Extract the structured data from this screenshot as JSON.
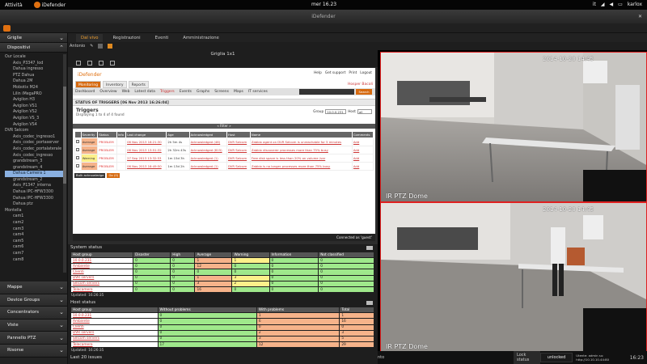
{
  "topbar": {
    "activities": "Attività",
    "app": "iDefender",
    "clock": "mer 16.23",
    "lang": "it",
    "user": "karlox"
  },
  "window": {
    "title": "iDefender"
  },
  "sidebar": {
    "top_sections": [
      {
        "label": "Griglie"
      },
      {
        "label": "Dispositivi"
      }
    ],
    "tree": [
      {
        "label": "Our Locale",
        "level": 1
      },
      {
        "label": "Axis_P3347_Iod",
        "level": 2
      },
      {
        "label": "Dahua ingresso",
        "level": 2
      },
      {
        "label": "PTZ Dahua",
        "level": 2
      },
      {
        "label": "Dahua 2M",
        "level": 2
      },
      {
        "label": "Mobotix M24",
        "level": 2
      },
      {
        "label": "Lilin iMegaPRO",
        "level": 2
      },
      {
        "label": "Avigilon H3",
        "level": 2
      },
      {
        "label": "Avigilon VS1",
        "level": 2
      },
      {
        "label": "Avigilon VS2",
        "level": 2
      },
      {
        "label": "Avigilon VS_3",
        "level": 2
      },
      {
        "label": "Avigilon VS4",
        "level": 2
      },
      {
        "label": "DVR Selcom",
        "level": 1
      },
      {
        "label": "Axis_codec_ingresso1",
        "level": 2
      },
      {
        "label": "Axis_codec_portaserver",
        "level": 2
      },
      {
        "label": "Axis_codec_portalaterale",
        "level": 2
      },
      {
        "label": "Axis_codec_ingresso",
        "level": 2
      },
      {
        "label": "grandstream_3",
        "level": 2
      },
      {
        "label": "grandstream_4",
        "level": 2
      },
      {
        "label": "Dahua Camera 1",
        "level": 2,
        "selected": true
      },
      {
        "label": "grandstream_2",
        "level": 2
      },
      {
        "label": "Axis_P1347_interna",
        "level": 2
      },
      {
        "label": "Dahua IPC-HFW3300",
        "level": 2
      },
      {
        "label": "Dahua IPC-HFW3300",
        "level": 2
      },
      {
        "label": "Dahua ptz",
        "level": 2
      },
      {
        "label": "Montella",
        "level": 1
      },
      {
        "label": "cam1",
        "level": 2
      },
      {
        "label": "cam2",
        "level": 2
      },
      {
        "label": "cam3",
        "level": 2
      },
      {
        "label": "cam4",
        "level": 2
      },
      {
        "label": "cam5",
        "level": 2
      },
      {
        "label": "cam6",
        "level": 2
      },
      {
        "label": "cam7",
        "level": 2
      },
      {
        "label": "cam8",
        "level": 2
      }
    ],
    "bottom_sections": [
      {
        "label": "Mappe"
      },
      {
        "label": "Device Groups"
      },
      {
        "label": "Concentrators"
      },
      {
        "label": "Viste"
      },
      {
        "label": "Pannello PTZ"
      },
      {
        "label": "Risorse"
      }
    ]
  },
  "tabs": [
    {
      "label": "Dal vivo",
      "active": true
    },
    {
      "label": "Registrazioni"
    },
    {
      "label": "Eventi"
    },
    {
      "label": "Amministrazione"
    }
  ],
  "subtoolbar": {
    "label": "Antonio"
  },
  "grid": {
    "title": "Griglia 1x1"
  },
  "zabbix": {
    "brand": "iDefender",
    "top_links": [
      "Help",
      "Get support",
      "Print",
      "Logout"
    ],
    "menu1": [
      "Monitoring",
      "Inventory",
      "Reports"
    ],
    "user": "Hosper Bacoli",
    "menu2": [
      "Dashboard",
      "Overview",
      "Web",
      "Latest data",
      "Triggers",
      "Events",
      "Graphs",
      "Screens",
      "Maps",
      "IT services"
    ],
    "search_btn": "Search",
    "status_title": "STATUS OF TRIGGERS [06 Nov 2013 16:26:04]",
    "triggers_title": "Triggers",
    "displaying": "Displaying 1 to 4 of 4 found",
    "group_label": "Group",
    "group_value": "10.0.0.231",
    "host_label": "Host",
    "host_value": "all",
    "filter": "« Filter »",
    "columns": [
      "",
      "Severity",
      "Status",
      "Info",
      "Last change",
      "Age",
      "Acknowledged",
      "Host",
      "Name",
      "Comments"
    ],
    "rows": [
      {
        "severity": "Average",
        "status": "PROBLEM",
        "last": "06 Nov 2013 16:21:30",
        "age": "2h 5m 4s",
        "ack": "Acknowledged (46)",
        "host": "DVR Selcom",
        "name": "Zabbix agent on DVR Selcom is unreachable for 5 minutes",
        "comment": "Add",
        "cls": "sev-avg"
      },
      {
        "severity": "Average",
        "status": "PROBLEM",
        "last": "06 Nov 2013 13:51:32",
        "age": "2h 32m 43s",
        "ack": "Acknowledged (815)",
        "host": "DVR Selcom",
        "name": "Zabbix discoverer processes more than 75% busy",
        "comment": "Add",
        "cls": "sev-avg"
      },
      {
        "severity": "Warning",
        "status": "PROBLEM",
        "last": "27 Sep 2013 13:32:53",
        "age": "1m 15d 3h",
        "ack": "Acknowledged (1)",
        "host": "DVR Selcom",
        "name": "Free disk space is less than 20% on volume /var",
        "comment": "Add",
        "cls": "sev-warn"
      },
      {
        "severity": "Average",
        "status": "PROBLEM",
        "last": "06 Nov 2013 16:49:50",
        "age": "1m 13d 2h",
        "ack": "Acknowledged (1)",
        "host": "DVR Selcom",
        "name": "Zabbix is no longer processes more than 75% busy",
        "comment": "Add",
        "cls": "sev-avg"
      }
    ],
    "bulk_ack": "Bulk acknowledge",
    "go": "Go (0)",
    "connected": "Connected as 'guest'"
  },
  "system_status": {
    "title": "System status",
    "columns": [
      "Host group",
      "Disaster",
      "High",
      "Average",
      "Warning",
      "Information",
      "Not classified"
    ],
    "rows": [
      {
        "group": "10.0.0.231",
        "vals": [
          "0",
          "0",
          "1",
          "1",
          "0",
          "0"
        ],
        "cls": [
          "c-g",
          "c-g",
          "c-o",
          "c-y",
          "c-g",
          "c-g"
        ]
      },
      {
        "group": "Ambiente",
        "vals": [
          "0",
          "0",
          "12",
          "0",
          "0",
          "0"
        ],
        "cls": [
          "c-g",
          "c-g",
          "c-o",
          "c-g",
          "c-g",
          "c-g"
        ]
      },
      {
        "group": "Clienti",
        "vals": [
          "0",
          "0",
          "0",
          "0",
          "0",
          "0"
        ],
        "cls": [
          "c-g",
          "c-g",
          "c-g",
          "c-g",
          "c-g",
          "c-g"
        ]
      },
      {
        "group": "DVR servers",
        "vals": [
          "0",
          "0",
          "1",
          "3",
          "0",
          "0"
        ],
        "cls": [
          "c-g",
          "c-g",
          "c-o",
          "c-y",
          "c-g",
          "c-g"
        ]
      },
      {
        "group": "Selcom servers",
        "vals": [
          "0",
          "0",
          "3",
          "2",
          "0",
          "0"
        ],
        "cls": [
          "c-g",
          "c-g",
          "c-o",
          "c-y",
          "c-g",
          "c-g"
        ]
      },
      {
        "group": "Telecamere",
        "vals": [
          "0",
          "0",
          "16",
          "0",
          "0",
          "0"
        ],
        "cls": [
          "c-g",
          "c-g",
          "c-o",
          "c-g",
          "c-g",
          "c-g"
        ]
      }
    ],
    "updated": "Updated: 16:26:35"
  },
  "host_status": {
    "title": "Host status",
    "columns": [
      "Host group",
      "Without problems",
      "With problems",
      "Total"
    ],
    "rows": [
      {
        "group": "10.0.0.231",
        "vals": [
          "0",
          "1",
          "1"
        ]
      },
      {
        "group": "Ambiente",
        "vals": [
          "0",
          "6",
          "16"
        ]
      },
      {
        "group": "Clienti",
        "vals": [
          "0",
          "0",
          "0"
        ]
      },
      {
        "group": "DVR servers",
        "vals": [
          "0",
          "2",
          "3"
        ]
      },
      {
        "group": "Selcom servers",
        "vals": [
          "0",
          "3",
          "5"
        ]
      },
      {
        "group": "Telecamere",
        "vals": [
          "17",
          "12",
          "29"
        ]
      }
    ],
    "updated": "Updated: 16:26:35"
  },
  "last_issues": {
    "title": "Last 20 issues"
  },
  "cameras": [
    {
      "timestamp": "2014-10-20 14:45",
      "label": "IR PTZ Dome"
    },
    {
      "timestamp": "2014-10-20 14:45",
      "label": "IR PTZ Dome"
    }
  ],
  "statusbar": {
    "lock_label": "Lock status",
    "lock_value": "unlocked",
    "user_info": "Utente: admin su: http://10.10.10.44:80",
    "time": "16:23",
    "left_text": "nto"
  }
}
